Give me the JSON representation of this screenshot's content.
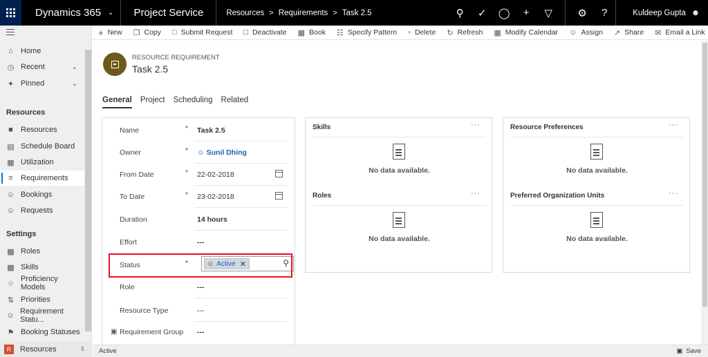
{
  "topbar": {
    "app_name": "Dynamics 365",
    "area_name": "Project Service",
    "breadcrumbs": [
      "Resources",
      "Requirements",
      "Task 2.5"
    ],
    "user": "Kuldeep Gupta"
  },
  "sidebar": {
    "top_items": [
      {
        "label": "Home",
        "icon": "home-icon"
      },
      {
        "label": "Recent",
        "icon": "clock-icon"
      },
      {
        "label": "Pinned",
        "icon": "pin-icon"
      }
    ],
    "section_resources": "Resources",
    "resources_items": [
      {
        "label": "Resources",
        "icon": "resource-icon"
      },
      {
        "label": "Schedule Board",
        "icon": "board-icon"
      },
      {
        "label": "Utilization",
        "icon": "chart-icon"
      },
      {
        "label": "Requirements",
        "icon": "list-icon"
      },
      {
        "label": "Bookings",
        "icon": "people-icon"
      },
      {
        "label": "Requests",
        "icon": "request-icon"
      }
    ],
    "section_settings": "Settings",
    "settings_items": [
      {
        "label": "Roles",
        "icon": "role-icon"
      },
      {
        "label": "Skills",
        "icon": "skill-icon"
      },
      {
        "label": "Proficiency Models",
        "icon": "star-icon"
      },
      {
        "label": "Priorities",
        "icon": "priority-icon"
      },
      {
        "label": "Requirement Statu...",
        "icon": "status-icon"
      },
      {
        "label": "Booking Statuses",
        "icon": "flag-icon"
      }
    ],
    "area_switcher": {
      "badge": "R",
      "label": "Resources"
    }
  },
  "commands": [
    "New",
    "Copy",
    "Submit Request",
    "Deactivate",
    "Book",
    "Specify Pattern",
    "Delete",
    "Refresh",
    "Modify Calendar",
    "Assign",
    "Share",
    "Email a Link"
  ],
  "record": {
    "entity_type": "RESOURCE REQUIREMENT",
    "title": "Task 2.5"
  },
  "tabs": [
    "General",
    "Project",
    "Scheduling",
    "Related"
  ],
  "form": {
    "name_label": "Name",
    "name_value": "Task 2.5",
    "owner_label": "Owner",
    "owner_value": "Sunil Dhing",
    "from_label": "From Date",
    "from_value": "22-02-2018",
    "to_label": "To Date",
    "to_value": "23-02-2018",
    "duration_label": "Duration",
    "duration_value": "14 hours",
    "effort_label": "Effort",
    "effort_value": "---",
    "status_label": "Status",
    "status_value": "Active",
    "role_label": "Role",
    "role_value": "---",
    "rtype_label": "Resource Type",
    "rtype_value": "---",
    "rgroup_label": "Requirement Group",
    "rgroup_value": "---"
  },
  "cards": {
    "skills": "Skills",
    "roles": "Roles",
    "res_prefs": "Resource Preferences",
    "pref_org": "Preferred Organization Units",
    "no_data": "No data available.",
    "more": "···"
  },
  "statusbar": {
    "status": "Active",
    "save": "Save"
  },
  "colors": {
    "topbar": "#000000",
    "waffle": "#002050",
    "accent": "#0078d4",
    "highlight": "#e81123"
  }
}
